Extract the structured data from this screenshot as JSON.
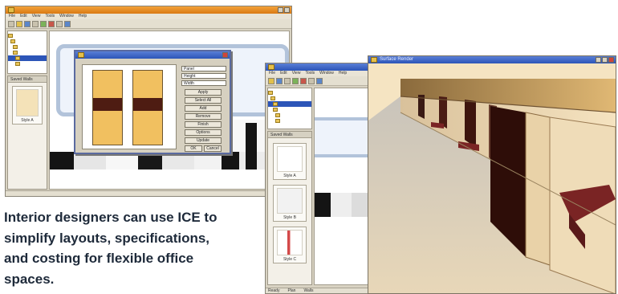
{
  "caption": {
    "lines": [
      "Interior designers can use ICE to",
      "simplify layouts, specifications,",
      "and costing for flexible office",
      "spaces."
    ]
  },
  "window_left": {
    "menu": [
      "File",
      "Edit",
      "View",
      "Tools",
      "Window",
      "Help"
    ],
    "side_panel_title": "Saved Walls",
    "thumbs": [
      "Style A"
    ]
  },
  "dialog": {
    "fields": [
      "Panel",
      "Height",
      "Width"
    ],
    "buttons": [
      "Apply",
      "Select All",
      "Add",
      "Remove",
      "Finish",
      "Options",
      "Update",
      "OK",
      "Cancel"
    ]
  },
  "window_middle": {
    "menu": [
      "File",
      "Edit",
      "View",
      "Tools",
      "Window",
      "Help"
    ],
    "side_panel_title": "Saved Walls",
    "thumbs": [
      "Style A",
      "Style B",
      "Style C"
    ],
    "status_items": [
      "Ready",
      "Plan",
      "Walls"
    ]
  },
  "window_render": {
    "title": "Surface Render"
  },
  "colors": {
    "titlebar_blue": "#2c55b8",
    "titlebar_orange": "#d97a14",
    "panel_gold": "#f1c060",
    "panel_dark": "#4e1c12",
    "caption_text": "#1e2a3a"
  }
}
